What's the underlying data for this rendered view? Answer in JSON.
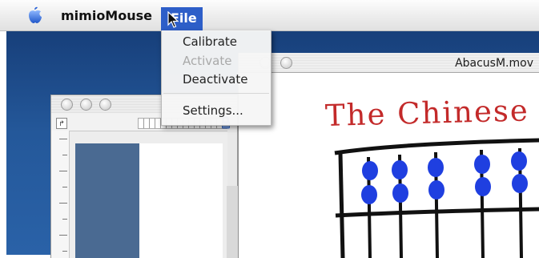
{
  "menubar": {
    "app_name": "mimioMouse",
    "file_menu_label": "File",
    "apple_icon": "apple-icon"
  },
  "file_menu": {
    "items": [
      {
        "label": "Calibrate",
        "enabled": true
      },
      {
        "label": "Activate",
        "enabled": false
      },
      {
        "label": "Deactivate",
        "enabled": true
      },
      {
        "label": "Settings...",
        "enabled": true
      }
    ]
  },
  "video_window": {
    "title": "AbacusM.mov",
    "caption": "The Chinese A"
  },
  "colors": {
    "menu_highlight": "#2d5ec8",
    "desktop": "#24589a",
    "caption_red": "#c32a2a",
    "bead_blue": "#1f3fe0"
  }
}
